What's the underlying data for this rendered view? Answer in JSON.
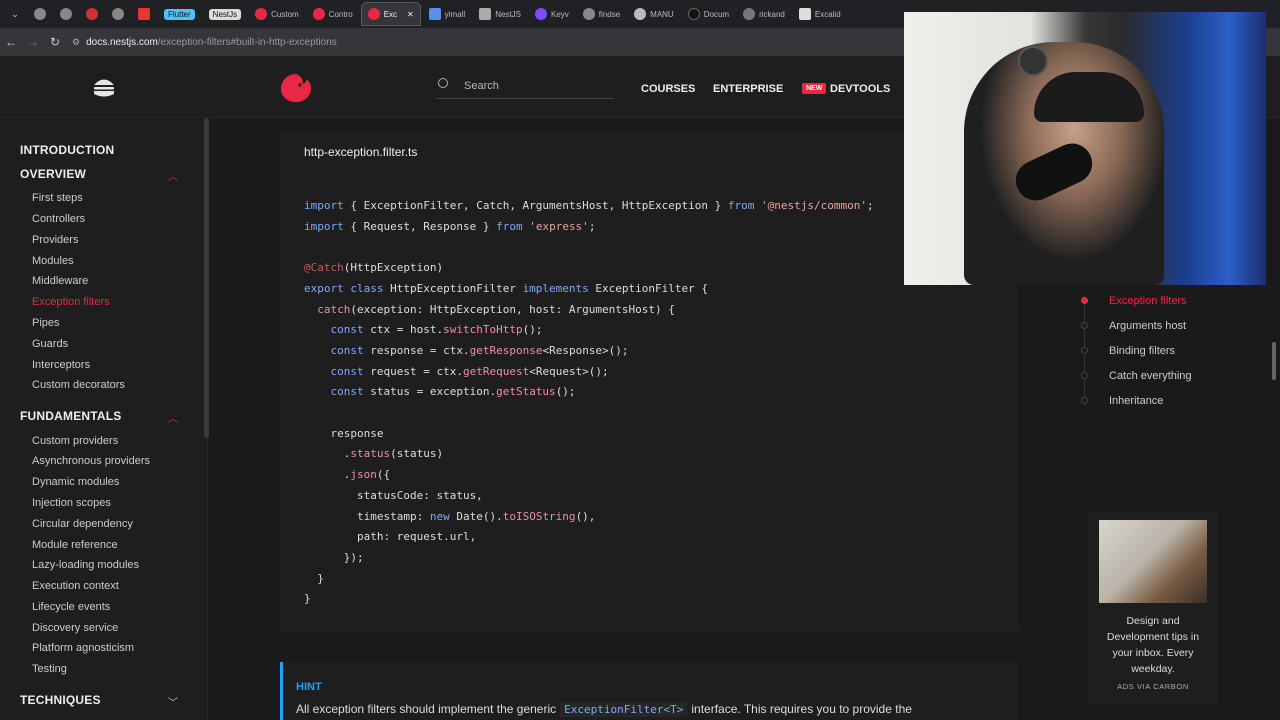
{
  "browser": {
    "tabs": [
      {
        "label": ""
      },
      {
        "label": ""
      },
      {
        "label": ""
      },
      {
        "label": ""
      },
      {
        "label": ""
      },
      {
        "label": "Flutter"
      },
      {
        "label": "NestJs"
      },
      {
        "label": "Custom"
      },
      {
        "label": "Contro"
      },
      {
        "label": "Exc",
        "active": true
      },
      {
        "label": "yimall"
      },
      {
        "label": "NestJS"
      },
      {
        "label": "Keyv"
      },
      {
        "label": "findse"
      },
      {
        "label": "MANU"
      },
      {
        "label": "Docum"
      },
      {
        "label": "rickand"
      },
      {
        "label": "Excalid"
      }
    ],
    "url_host": "docs.nestjs.com",
    "url_path": "/exception-filters#built-in-http-exceptions"
  },
  "header": {
    "search_placeholder": "Search",
    "nav": [
      "COURSES",
      "ENTERPRISE"
    ],
    "new_badge": "NEW",
    "devtools": "DEVTOOLS"
  },
  "sidebar": {
    "introduction": "INTRODUCTION",
    "overview": "OVERVIEW",
    "overview_items": [
      "First steps",
      "Controllers",
      "Providers",
      "Modules",
      "Middleware",
      "Exception filters",
      "Pipes",
      "Guards",
      "Interceptors",
      "Custom decorators"
    ],
    "active_item": "Exception filters",
    "fundamentals": "FUNDAMENTALS",
    "fundamentals_items": [
      "Custom providers",
      "Asynchronous providers",
      "Dynamic modules",
      "Injection scopes",
      "Circular dependency",
      "Module reference",
      "Lazy-loading modules",
      "Execution context",
      "Lifecycle events",
      "Discovery service",
      "Platform agnosticism",
      "Testing"
    ],
    "techniques": "TECHNIQUES"
  },
  "code": {
    "filename": "http-exception.filter.ts"
  },
  "hint": {
    "title": "HINT",
    "text_before": "All exception filters should implement the generic",
    "code": "ExceptionFilter<T>",
    "text_after": "interface. This requires you to provide the"
  },
  "toc": {
    "items": [
      "Exception filters",
      "Arguments host",
      "Binding filters",
      "Catch everything",
      "Inheritance"
    ],
    "active": "Exception filters"
  },
  "ad": {
    "text": "Design and Development tips in your inbox. Every weekday.",
    "via": "ADS VIA CARBON"
  },
  "colors": {
    "accent": "#ea2845",
    "hint": "#2a9ef0",
    "background": "#1a1a1a"
  }
}
